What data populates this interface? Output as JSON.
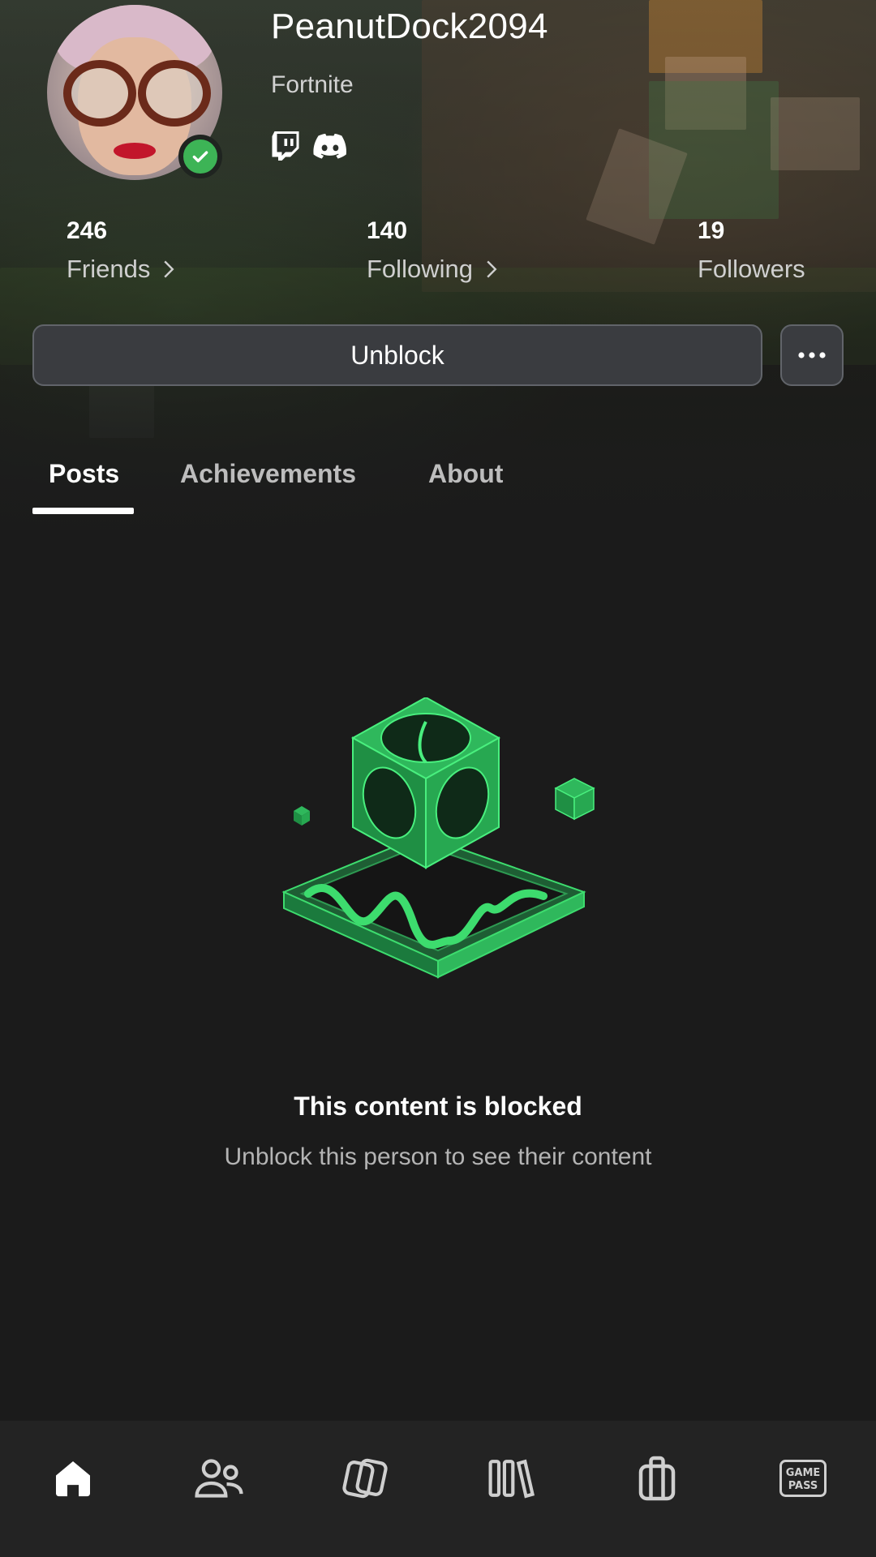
{
  "profile": {
    "username": "PeanutDock2094",
    "current_game": "Fortnite",
    "verified": true,
    "social_links": [
      "twitch-icon",
      "discord-icon"
    ]
  },
  "stats": [
    {
      "value": "246",
      "label": "Friends",
      "has_chevron": true
    },
    {
      "value": "140",
      "label": "Following",
      "has_chevron": true
    },
    {
      "value": "19",
      "label": "Followers",
      "has_chevron": false
    }
  ],
  "actions": {
    "primary_label": "Unblock",
    "more_icon": "more-horizontal-icon"
  },
  "tabs": [
    {
      "label": "Posts",
      "active": true
    },
    {
      "label": "Achievements",
      "active": false
    },
    {
      "label": "About",
      "active": false
    }
  ],
  "empty_state": {
    "title": "This content is blocked",
    "subtitle": "Unblock this person to see their content",
    "illustration": "blocked-cube-illustration"
  },
  "bottom_nav": [
    {
      "icon": "home-icon",
      "active": true
    },
    {
      "icon": "social-icon",
      "active": false
    },
    {
      "icon": "games-icon",
      "active": false
    },
    {
      "icon": "library-icon",
      "active": false
    },
    {
      "icon": "store-icon",
      "active": false
    },
    {
      "icon": "game-pass-icon",
      "text": "GAME PASS",
      "active": false
    }
  ],
  "colors": {
    "background": "#1b1b1b",
    "accent_green": "#3db456",
    "nav_background": "#232323"
  }
}
